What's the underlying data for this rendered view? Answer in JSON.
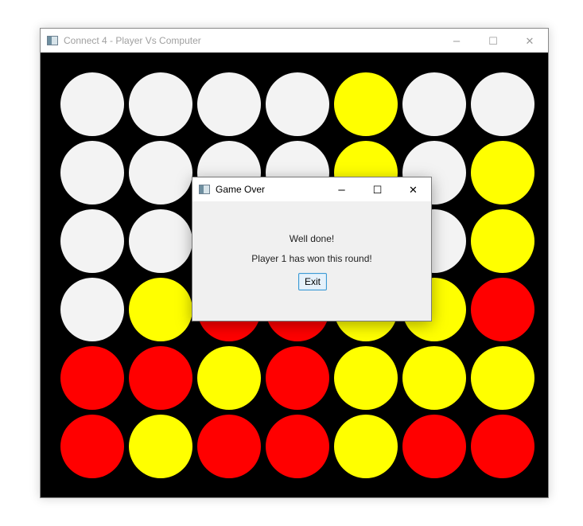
{
  "main_window": {
    "title": "Connect 4 - Player Vs Computer",
    "controls": {
      "minimize": "–",
      "maximize": "☐",
      "close": "✕"
    }
  },
  "board": {
    "rows": 6,
    "cols": 7,
    "cells": [
      [
        "empty",
        "empty",
        "empty",
        "empty",
        "yellow",
        "empty",
        "empty"
      ],
      [
        "empty",
        "empty",
        "empty",
        "empty",
        "yellow",
        "empty",
        "yellow"
      ],
      [
        "empty",
        "empty",
        "empty",
        "empty",
        "empty",
        "empty",
        "yellow"
      ],
      [
        "empty",
        "yellow",
        "red",
        "red",
        "yellow",
        "yellow",
        "red"
      ],
      [
        "red",
        "red",
        "yellow",
        "red",
        "yellow",
        "yellow",
        "yellow"
      ],
      [
        "red",
        "yellow",
        "red",
        "red",
        "yellow",
        "red",
        "red"
      ]
    ],
    "colors": {
      "empty": "#f3f3f3",
      "yellow": "#ffff00",
      "red": "#ff0000",
      "background": "#000000"
    }
  },
  "dialog": {
    "title": "Game Over",
    "message_line1": "Well done!",
    "message_line2": "Player 1 has won this round!",
    "exit_label": "Exit",
    "controls": {
      "minimize": "–",
      "maximize": "☐",
      "close": "✕"
    }
  }
}
